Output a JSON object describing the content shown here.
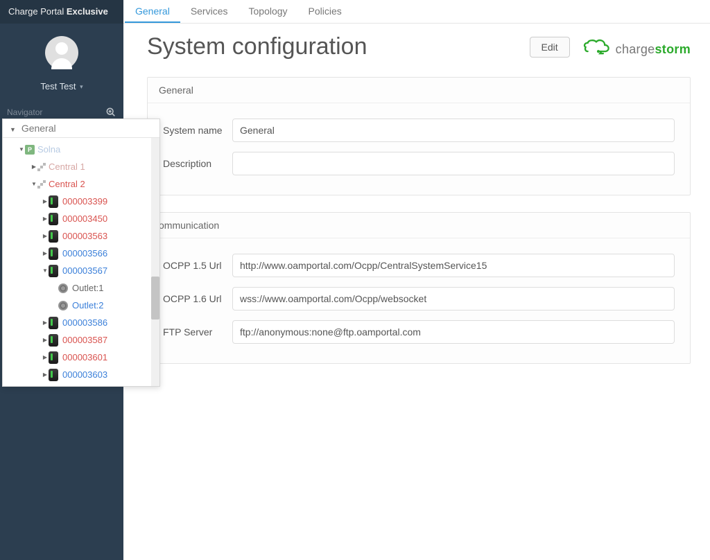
{
  "brand": {
    "fixed": "Charge Portal ",
    "bold": "Exclusive"
  },
  "user": {
    "name": "Test Test"
  },
  "navigator": {
    "label": "Navigator",
    "root": "General"
  },
  "tree": {
    "site": "Solna",
    "central1": "Central 1",
    "central2": "Central 2",
    "devices": [
      {
        "id": "000003399",
        "cls": "t-red"
      },
      {
        "id": "000003450",
        "cls": "t-red"
      },
      {
        "id": "000003563",
        "cls": "t-red"
      },
      {
        "id": "000003566",
        "cls": "t-blue"
      },
      {
        "id": "000003567",
        "cls": "t-blue",
        "expanded": true,
        "outlets": [
          {
            "label": "Outlet:1",
            "cls": "t-grey"
          },
          {
            "label": "Outlet:2",
            "cls": "t-blue"
          }
        ]
      },
      {
        "id": "000003586",
        "cls": "t-blue"
      },
      {
        "id": "000003587",
        "cls": "t-red"
      },
      {
        "id": "000003601",
        "cls": "t-red"
      },
      {
        "id": "000003603",
        "cls": "t-blue"
      }
    ]
  },
  "tabs": [
    {
      "key": "general",
      "label": "General",
      "active": true
    },
    {
      "key": "services",
      "label": "Services",
      "active": false
    },
    {
      "key": "topology",
      "label": "Topology",
      "active": false
    },
    {
      "key": "policies",
      "label": "Policies",
      "active": false
    }
  ],
  "page": {
    "title": "System configuration",
    "editLabel": "Edit"
  },
  "logo": {
    "a": "charge",
    "b": "storm"
  },
  "cards": {
    "general": {
      "title": "General",
      "fields": {
        "systemNameLabel": "System name",
        "systemNameValue": "General",
        "descriptionLabel": "Description",
        "descriptionValue": ""
      }
    },
    "communication": {
      "title": "ommunication",
      "fields": {
        "ocpp15Label": "OCPP 1.5 Url",
        "ocpp15Value": "http://www.oamportal.com/Ocpp/CentralSystemService15",
        "ocpp16Label": "OCPP 1.6 Url",
        "ocpp16Value": "wss://www.oamportal.com/Ocpp/websocket",
        "ftpLabel": "FTP Server",
        "ftpValue": "ftp://anonymous:none@ftp.oamportal.com"
      }
    }
  }
}
